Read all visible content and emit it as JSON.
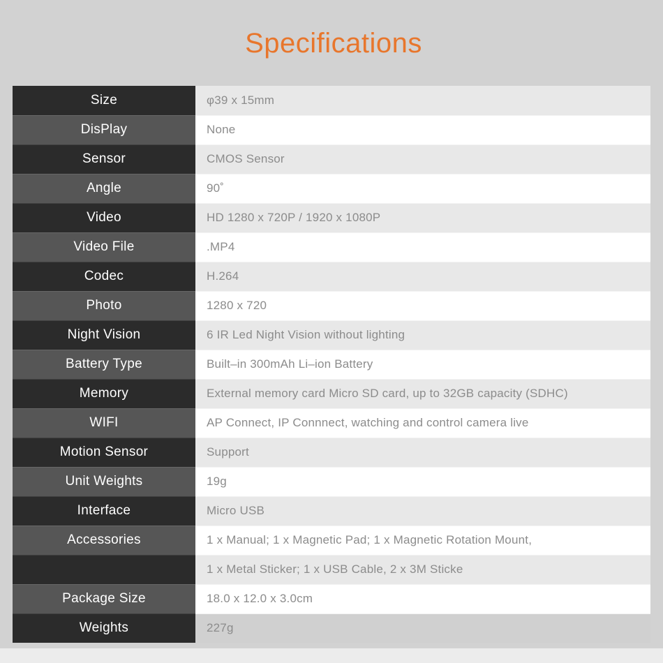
{
  "page": {
    "title": "Specifications",
    "background_color": "#d2d2d2",
    "title_color": "#e8762c"
  },
  "table": {
    "label_column_dark": "#2b2b2b",
    "label_column_mid": "#565656",
    "value_column_tint": "#e8e8e8",
    "value_column_plain": "#ffffff",
    "value_text_color": "#8c8c8c",
    "rows": [
      {
        "label": "Size",
        "value": "φ39 x 15mm"
      },
      {
        "label": "DisPlay",
        "value": "None"
      },
      {
        "label": "Sensor",
        "value": "CMOS Sensor"
      },
      {
        "label": "Angle",
        "value": "90˚"
      },
      {
        "label": "Video",
        "value": "HD 1280 x 720P / 1920 x 1080P"
      },
      {
        "label": "Video File",
        "value": ".MP4"
      },
      {
        "label": "Codec",
        "value": "H.264"
      },
      {
        "label": "Photo",
        "value": "1280 x 720"
      },
      {
        "label": "Night Vision",
        "value": "6 IR Led Night Vision without lighting"
      },
      {
        "label": "Battery Type",
        "value": "Built–in 300mAh Li–ion Battery"
      },
      {
        "label": "Memory",
        "value": "External memory card Micro SD card, up to 32GB capacity (SDHC)"
      },
      {
        "label": "WIFI",
        "value": "AP Connect,  IP Connnect, watching and control camera live"
      },
      {
        "label": "Motion Sensor",
        "value": "Support"
      },
      {
        "label": "Unit Weights",
        "value": "19g"
      },
      {
        "label": "Interface",
        "value": "Micro USB"
      },
      {
        "label": "Accessories",
        "value": "1 x Manual; 1 x Magnetic Pad; 1 x Magnetic Rotation Mount,"
      },
      {
        "label": "",
        "value": "1 x Metal Sticker; 1 x USB Cable, 2 x 3M Sticke"
      },
      {
        "label": "Package Size",
        "value": "18.0 x 12.0 x 3.0cm"
      },
      {
        "label": "Weights",
        "value": "227g"
      }
    ]
  }
}
